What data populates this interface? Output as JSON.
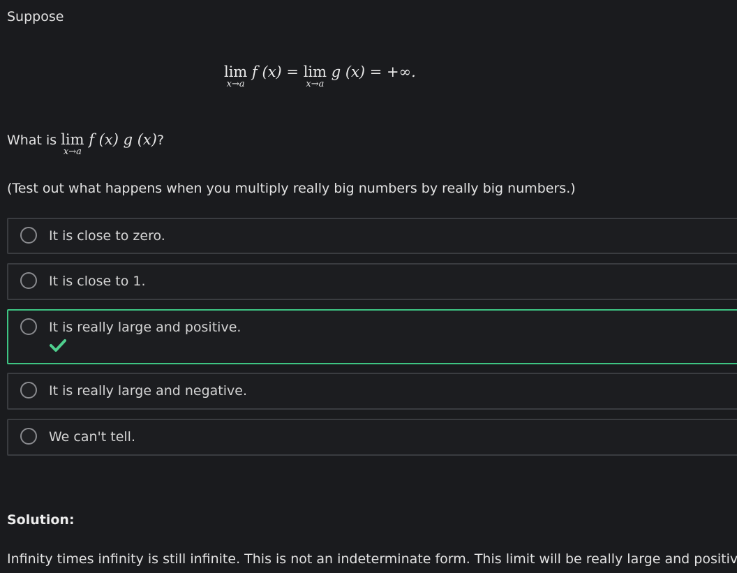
{
  "intro_text": "Suppose",
  "display_equation": {
    "lim_word": "lim",
    "subscript": "x→a",
    "f_part": "f (x) =",
    "g_part": "g (x) = +∞."
  },
  "question": {
    "prefix": "What is",
    "lim_word": "lim",
    "subscript": "x→a",
    "expression": "f (x) g (x)",
    "suffix": "?"
  },
  "hint": "(Test out what happens when you multiply really big numbers by really big numbers.)",
  "options": [
    {
      "label": "It is close to zero.",
      "correct": false
    },
    {
      "label": "It is close to 1.",
      "correct": false
    },
    {
      "label": "It is really large and positive.",
      "correct": true
    },
    {
      "label": "It is really large and negative.",
      "correct": false
    },
    {
      "label": "We can't tell.",
      "correct": false
    }
  ],
  "correct_icon": "checkmark-icon",
  "colors": {
    "background": "#1a1b1e",
    "correct_border": "#3ec583",
    "check": "#4fd08e"
  },
  "solution": {
    "title": "Solution:",
    "text": "Infinity times infinity is still infinite. This is not an indeterminate form. This limit will be really large and positive."
  }
}
